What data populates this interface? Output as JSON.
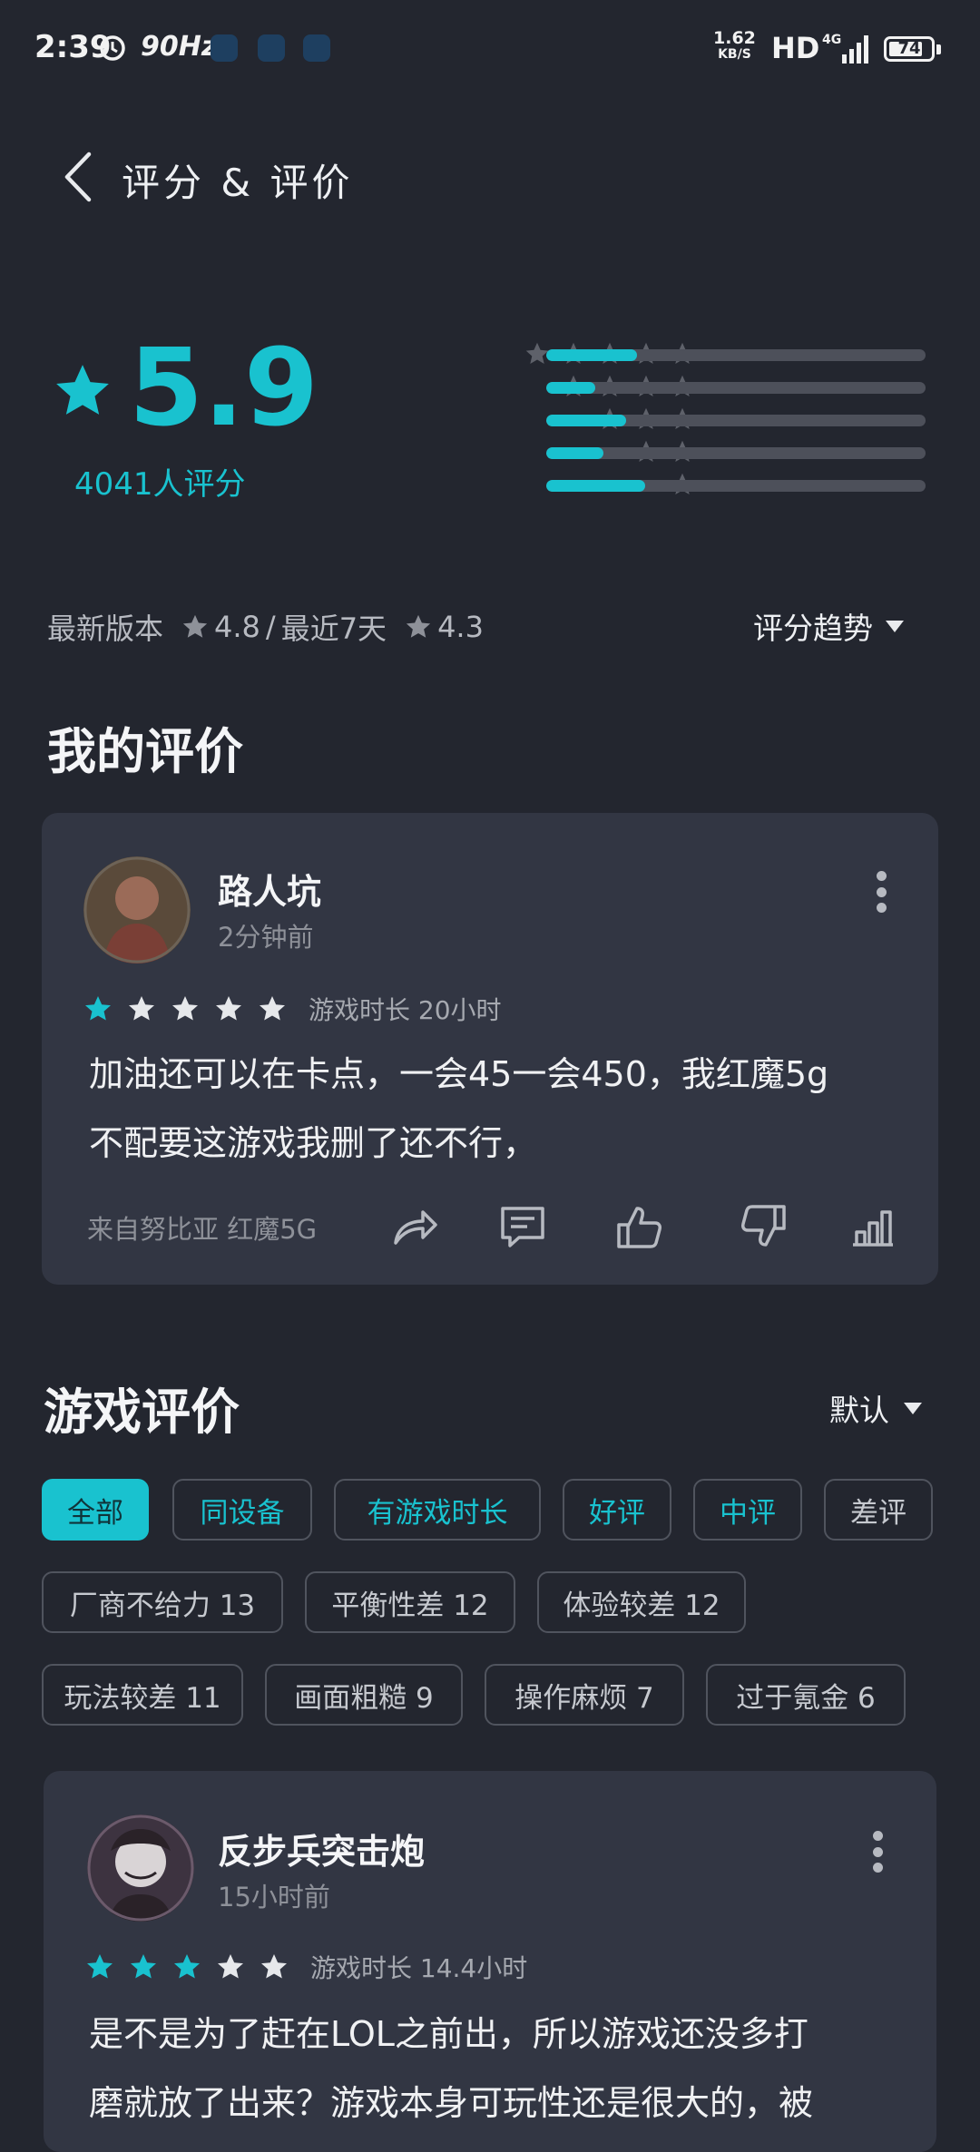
{
  "status_bar": {
    "time": "2:39",
    "refresh_rate": "90Hz",
    "net_speed_value": "1.62",
    "net_speed_unit": "KB/S",
    "hd": "HD",
    "network": "4G",
    "battery": "74"
  },
  "header": {
    "title": "评分 & 评价"
  },
  "rating": {
    "score": "5.9",
    "count_label": "4041人评分",
    "distribution": [
      {
        "stars": 5,
        "fraction": 0.24
      },
      {
        "stars": 4,
        "fraction": 0.13
      },
      {
        "stars": 3,
        "fraction": 0.21
      },
      {
        "stars": 2,
        "fraction": 0.15
      },
      {
        "stars": 1,
        "fraction": 0.26
      }
    ]
  },
  "version_line": {
    "latest_label": "最新版本",
    "latest_score": "4.8",
    "separator": "/",
    "recent_label": "最近7天",
    "recent_score": "4.3",
    "trend_label": "评分趋势"
  },
  "my_review": {
    "section_title": "我的评价",
    "user": "路人坑",
    "time": "2分钟前",
    "stars": 1,
    "playtime": "游戏时长 20小时",
    "text_line1": "加油还可以在卡点，一会45一会450，我红魔5g",
    "text_line2": "不配要这游戏我删了还不行，",
    "source": "来自努比亚 红魔5G"
  },
  "game_reviews": {
    "section_title": "游戏评价",
    "sort_label": "默认",
    "filters_row1": [
      "全部",
      "同设备",
      "有游戏时长",
      "好评",
      "中评",
      "差评"
    ],
    "filters_row2": [
      "厂商不给力 13",
      "平衡性差 12",
      "体验较差 12"
    ],
    "filters_row3": [
      "玩法较差 11",
      "画面粗糙 9",
      "操作麻烦 7",
      "过于氪金 6"
    ]
  },
  "review2": {
    "user": "反步兵突击炮",
    "time": "15小时前",
    "stars": 3,
    "playtime": "游戏时长 14.4小时",
    "text_line1": "是不是为了赶在LOL之前出，所以游戏还没多打",
    "text_line2": "磨就放了出来？游戏本身可玩性还是很大的，被"
  },
  "colors": {
    "background": "#23262f",
    "card": "#323643",
    "accent": "#19c2cf",
    "track": "#4d505a"
  },
  "icons": [
    "alarm-icon",
    "back-arrow-icon",
    "star-icon",
    "more-vertical-icon",
    "share-icon",
    "comment-icon",
    "thumb-up-icon",
    "thumb-down-icon",
    "bar-chart-icon",
    "caret-down-icon"
  ]
}
